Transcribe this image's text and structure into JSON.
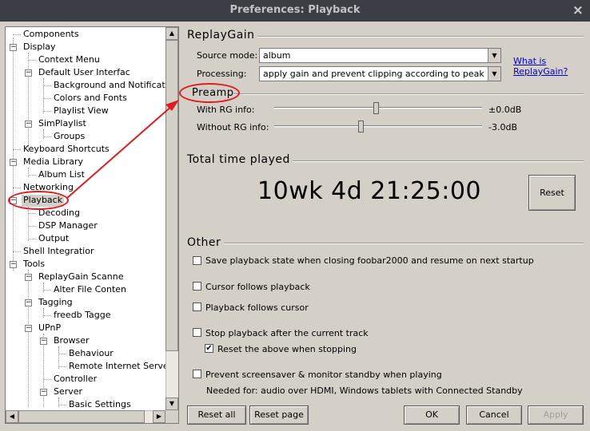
{
  "window": {
    "title": "Preferences: Playback",
    "close_icon": "×"
  },
  "tree": {
    "items": [
      {
        "label": "Components"
      },
      {
        "label": "Display"
      },
      {
        "label": "Context Menu"
      },
      {
        "label": "Default User Interfac"
      },
      {
        "label": "Background and Notificati"
      },
      {
        "label": "Colors and Fonts"
      },
      {
        "label": "Playlist View"
      },
      {
        "label": "SimPlaylist"
      },
      {
        "label": "Groups"
      },
      {
        "label": "Keyboard Shortcuts"
      },
      {
        "label": "Media Library"
      },
      {
        "label": "Album List"
      },
      {
        "label": "Networking"
      },
      {
        "label": "Playback"
      },
      {
        "label": "Decoding"
      },
      {
        "label": "DSP Manager"
      },
      {
        "label": "Output"
      },
      {
        "label": "Shell Integratior"
      },
      {
        "label": "Tools"
      },
      {
        "label": "ReplayGain Scanne"
      },
      {
        "label": "Alter File Conten"
      },
      {
        "label": "Tagging"
      },
      {
        "label": "freedb Tagge"
      },
      {
        "label": "UPnP"
      },
      {
        "label": "Browser"
      },
      {
        "label": "Behaviour"
      },
      {
        "label": "Remote Internet Server"
      },
      {
        "label": "Controller"
      },
      {
        "label": "Server"
      },
      {
        "label": "Basic Settings"
      }
    ],
    "selected": "Playback",
    "expander_minus": "−"
  },
  "replaygain": {
    "title": "ReplayGain",
    "source_mode_label": "Source mode:",
    "source_mode_value": "album",
    "processing_label": "Processing:",
    "processing_value": "apply gain and prevent clipping according to peak",
    "help_link_line1": "What is",
    "help_link_line2": "ReplayGain?"
  },
  "preamp": {
    "title": "Preamp",
    "with_rg_label": "With RG info:",
    "with_rg_value": "±0.0dB",
    "with_rg_level": 0.5,
    "without_rg_label": "Without RG info:",
    "without_rg_value": "-3.0dB",
    "without_rg_level": 0.42
  },
  "total_time": {
    "title": "Total time played",
    "value": "10wk 4d 21:25:00",
    "reset_label": "Reset"
  },
  "other": {
    "title": "Other",
    "options": [
      {
        "label": "Save playback state when closing foobar2000 and resume on next startup",
        "checked": false
      },
      {
        "label": "Cursor follows playback",
        "checked": false
      },
      {
        "label": "Playback follows cursor",
        "checked": false
      },
      {
        "label": "Stop playback after the current track",
        "checked": false
      },
      {
        "label": "Reset the above when stopping",
        "checked": true
      },
      {
        "label": "Prevent screensaver & monitor standby when playing",
        "checked": false
      }
    ],
    "note": "Needed for: audio over HDMI, Windows tablets with Connected Standby",
    "check_mark": "✔"
  },
  "footer": {
    "reset_all": "Reset all",
    "reset_page": "Reset page",
    "ok": "OK",
    "cancel": "Cancel",
    "apply": "Apply"
  },
  "scroll": {
    "up": "▲",
    "down": "▼",
    "left": "◀",
    "right": "▶",
    "dropdown": "▼"
  },
  "colors": {
    "annotation": "#e21b1b",
    "titlebar": "#3b3f45",
    "link": "#0000cc"
  }
}
